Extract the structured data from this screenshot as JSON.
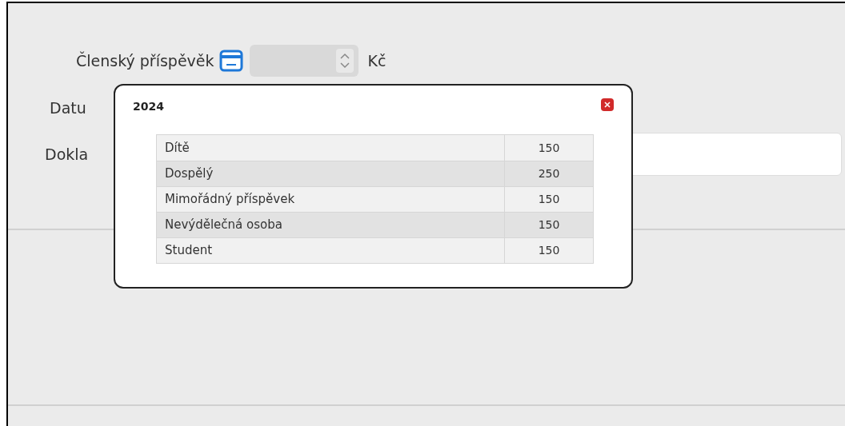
{
  "form": {
    "fee_label": "Členský příspěvěk",
    "fee_unit": "Kč",
    "date_label": "Datu",
    "document_label": "Dokla"
  },
  "popup": {
    "title": "2024",
    "rows": [
      {
        "name": "Dítě",
        "value": "150"
      },
      {
        "name": "Dospělý",
        "value": "250"
      },
      {
        "name": "Mimořádný příspěvek",
        "value": "150"
      },
      {
        "name": "Nevýdělečná osoba",
        "value": "150"
      },
      {
        "name": "Student",
        "value": "150"
      }
    ]
  }
}
